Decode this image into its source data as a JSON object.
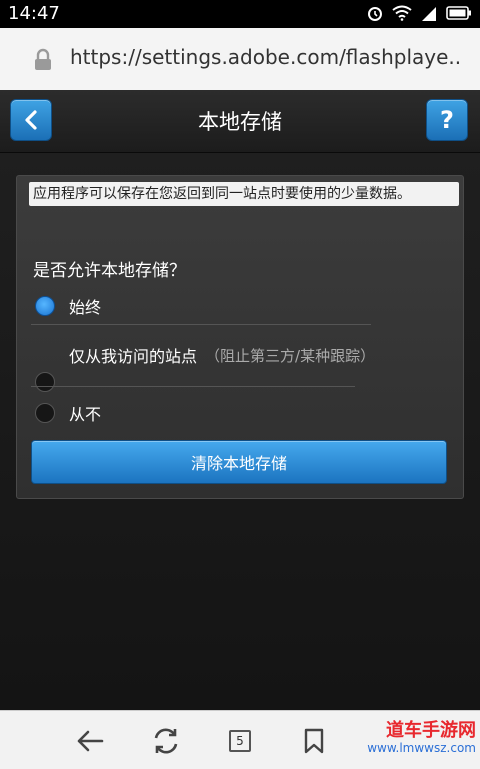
{
  "status_bar": {
    "time": "14:47"
  },
  "browser": {
    "url": "https://settings.adobe.com/flashplaye.."
  },
  "header": {
    "title": "本地存储",
    "help_label": "?"
  },
  "panel": {
    "description": "应用程序可以保存在您返回到同一站点时要使用的少量数据。",
    "question": "是否允许本地存储？",
    "options": [
      {
        "label": "始终",
        "note": "",
        "selected": true
      },
      {
        "label": "仅从我访问的站点",
        "note": "（阻止第三方/某种跟踪）",
        "selected": false
      },
      {
        "label": "从不",
        "note": "",
        "selected": false
      }
    ],
    "clear_button": "清除本地存储"
  },
  "nav": {
    "tab_count": "5"
  },
  "watermark": {
    "main": "道车手游网",
    "sub": "www.lmwwsz.com"
  },
  "colors": {
    "accent": "#1f7fd0",
    "panel_bg": "#353535",
    "background": "#1a1a1a"
  }
}
